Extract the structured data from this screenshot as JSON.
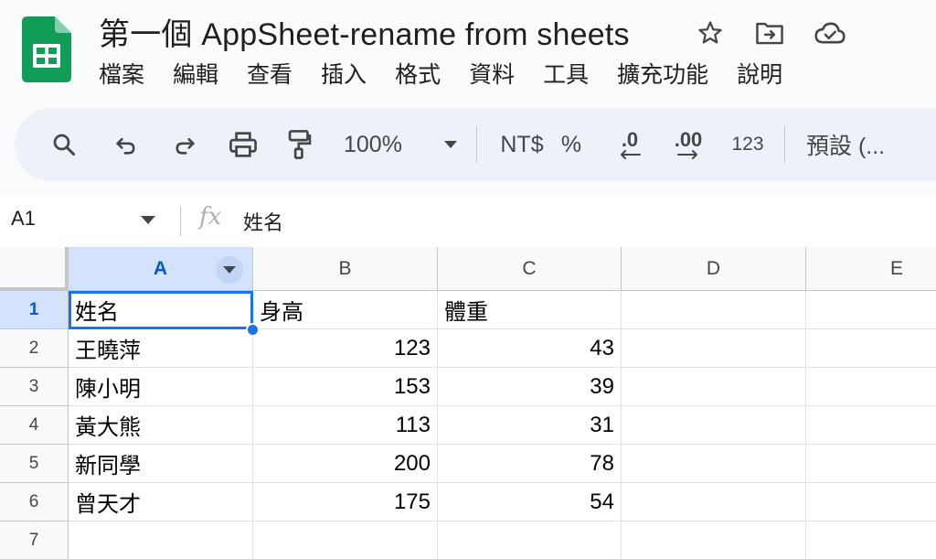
{
  "app": {
    "title": "第一個 AppSheet-rename from sheets",
    "brand_color": "#0f9d58"
  },
  "title_icons": [
    "star-icon",
    "move-to-folder-icon",
    "cloud-saved-icon"
  ],
  "menu": [
    "檔案",
    "編輯",
    "查看",
    "插入",
    "格式",
    "資料",
    "工具",
    "擴充功能",
    "說明"
  ],
  "toolbar": {
    "icons": [
      "search-icon",
      "undo-icon",
      "redo-icon",
      "print-icon",
      "paint-format-icon"
    ],
    "zoom": "100%",
    "currency": "NT$",
    "percent": "%",
    "decrease_decimal": ".0",
    "increase_decimal": ".00",
    "number_format": "123",
    "font": "預設 (..."
  },
  "formula_bar": {
    "cell_ref": "A1",
    "fx": "fx",
    "value": "姓名"
  },
  "sheet": {
    "columns": [
      "A",
      "B",
      "C",
      "D",
      "E"
    ],
    "selected_column": "A",
    "selected_row": "1",
    "selection_color": "#1a73e8",
    "rows": [
      {
        "num": "1",
        "cells": [
          "姓名",
          "身高",
          "體重",
          "",
          ""
        ]
      },
      {
        "num": "2",
        "cells": [
          "王曉萍",
          "123",
          "43",
          "",
          ""
        ]
      },
      {
        "num": "3",
        "cells": [
          "陳小明",
          "153",
          "39",
          "",
          ""
        ]
      },
      {
        "num": "4",
        "cells": [
          "黃大熊",
          "113",
          "31",
          "",
          ""
        ]
      },
      {
        "num": "5",
        "cells": [
          "新同學",
          "200",
          "78",
          "",
          ""
        ]
      },
      {
        "num": "6",
        "cells": [
          "曾天才",
          "175",
          "54",
          "",
          ""
        ]
      },
      {
        "num": "7",
        "cells": [
          "",
          "",
          "",
          "",
          ""
        ]
      }
    ]
  }
}
